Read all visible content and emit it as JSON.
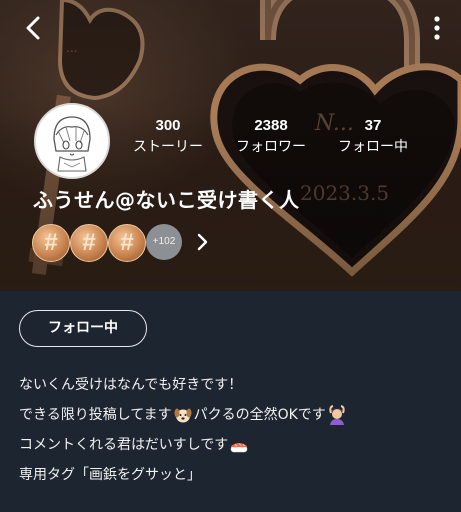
{
  "header": {
    "back_icon": "chevron-left-icon",
    "more_icon": "more-vertical-icon"
  },
  "profile": {
    "avatar": "anime-character-avatar",
    "username": "ふうせん@ないこ受け書く人",
    "stats": [
      {
        "value": "300",
        "label": "ストーリー"
      },
      {
        "value": "2388",
        "label": "フォロワー"
      },
      {
        "value": "37",
        "label": "フォロー中"
      }
    ],
    "badges": {
      "items": [
        "#",
        "#",
        "#"
      ],
      "more_count": "+102",
      "badge_color": "#c98450"
    },
    "follow_button": "フォロー中",
    "bio": [
      {
        "text": "ないくん受けはなんでも好きです！",
        "emoji": ""
      },
      {
        "text": "できる限り投稿してます",
        "emoji_mid": "dog-face-emoji",
        "text2": "パクるの全然OKです",
        "emoji_end": "woman-gesturing-ok-emoji"
      },
      {
        "text": "コメントくれる君はだいすしです",
        "emoji_end": "sushi-emoji"
      },
      {
        "text": "専用タグ「画鋲をグサッと」"
      }
    ]
  },
  "colors": {
    "background": "#1c2530",
    "text": "#ffffff"
  }
}
